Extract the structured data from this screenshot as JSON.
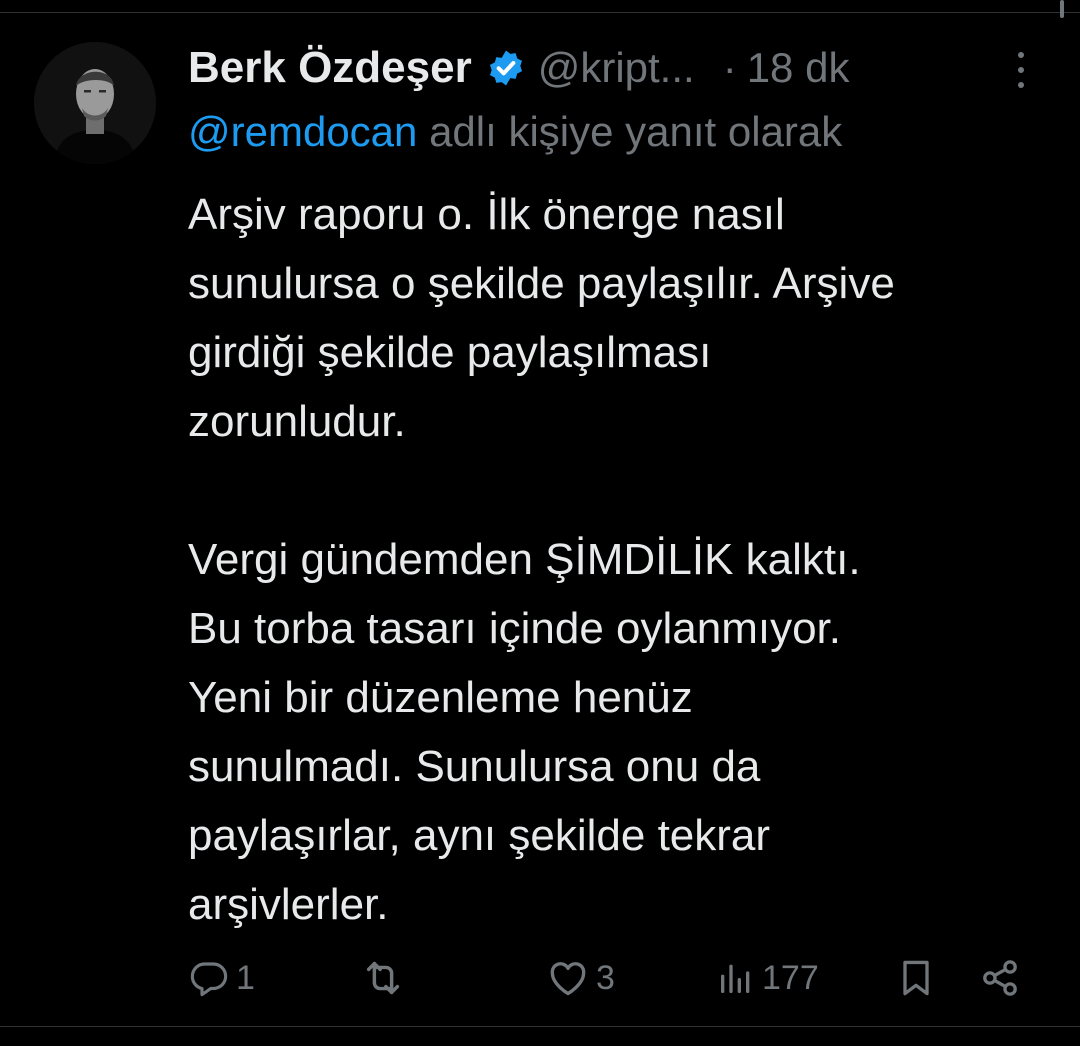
{
  "tweet": {
    "author": {
      "name": "Berk Özdeşer",
      "handle": "@kript...",
      "verified": true
    },
    "time_separator": "·",
    "time": "18 dk",
    "reply": {
      "mention": "@remdocan",
      "suffix": "adlı kişiye yanıt olarak"
    },
    "text_lines": [
      "Arşiv raporu o. İlk önerge nasıl",
      "sunulursa o şekilde paylaşılır. Arşive",
      "girdiği şekilde paylaşılması",
      "zorunludur.",
      "",
      "Vergi gündemden ŞİMDİLİK kalktı.",
      "Bu torba tasarı içinde oylanmıyor.",
      "Yeni bir düzenleme henüz",
      "sunulmadı. Sunulursa onu da",
      "paylaşırlar, aynı şekilde tekrar",
      "arşivlerler."
    ],
    "actions": {
      "reply_count": "1",
      "repost_count": "",
      "like_count": "3",
      "views_count": "177"
    }
  },
  "colors": {
    "background": "#000000",
    "text": "#e7e9ea",
    "secondary": "#71767b",
    "accent": "#1d9bf0",
    "divider": "#2f3336"
  },
  "icons": [
    "verified-badge-icon",
    "more-icon",
    "reply-icon",
    "repost-icon",
    "like-icon",
    "views-icon",
    "bookmark-icon",
    "share-icon"
  ]
}
